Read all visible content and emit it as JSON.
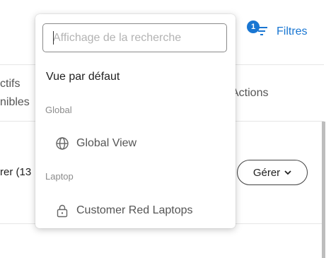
{
  "filters": {
    "badge": "1",
    "label": "Filtres",
    "icon": "filter-icon"
  },
  "table": {
    "col_active_line1": "ctifs",
    "col_active_line2": "nibles",
    "col_actions": "Actions",
    "row_text": "rer (13",
    "manage_label": "Gérer"
  },
  "dropdown": {
    "search_placeholder": "Affichage de la recherche",
    "default_option": "Vue par défaut",
    "groups": [
      {
        "label": "Global",
        "items": [
          {
            "label": "Global View",
            "icon": "globe-icon"
          }
        ]
      },
      {
        "label": "Laptop",
        "items": [
          {
            "label": "Customer Red Laptops",
            "icon": "lock-icon"
          }
        ]
      }
    ]
  },
  "colors": {
    "accent": "#1976d2"
  }
}
